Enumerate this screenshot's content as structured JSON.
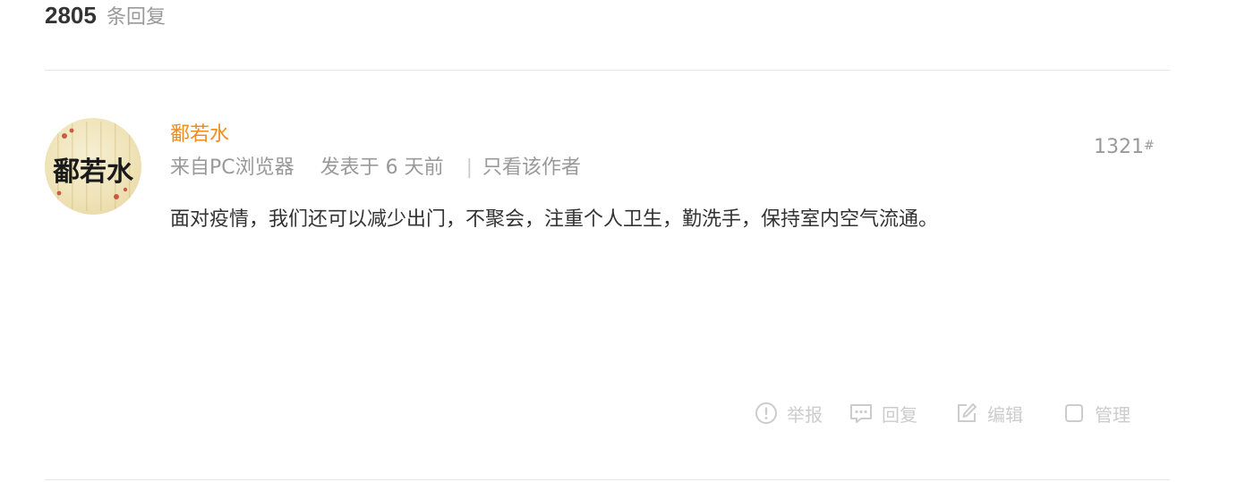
{
  "reply_count": {
    "number": "2805",
    "label": "条回复"
  },
  "post": {
    "author": "鄱若水",
    "source": "来自PC浏览器",
    "posted_time": "发表于 6 天前",
    "separator": "|",
    "only_author_label": "只看该作者",
    "floor_number": "1321",
    "floor_suffix": "#",
    "content": "面对疫情，我们还可以减少出门，不聚会，注重个人卫生，勤洗手，保持室内空气流通。",
    "avatar_text": "鄱若水",
    "actions": {
      "report": "举报",
      "reply": "回复",
      "edit": "编辑",
      "manage": "管理"
    }
  },
  "icons": {
    "report": "exclamation-circle-icon",
    "reply": "chat-bubble-icon",
    "edit": "pencil-square-icon",
    "manage": "checkbox-icon"
  },
  "colors": {
    "author": "#f08c1e",
    "muted": "#999999",
    "action": "#cccccc",
    "text": "#333333",
    "divider": "#e6e6e6"
  }
}
